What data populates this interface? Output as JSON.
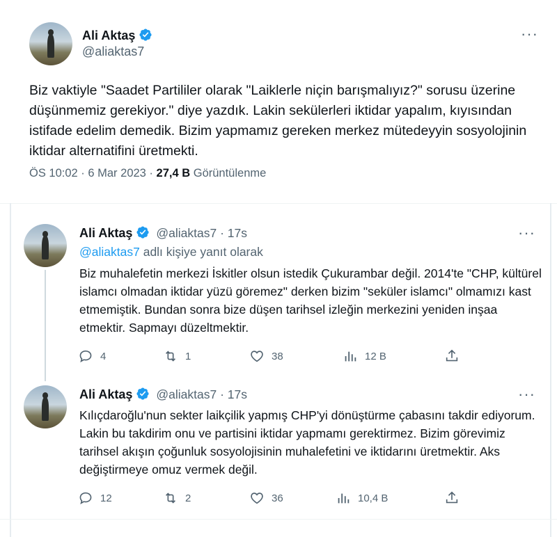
{
  "main_tweet": {
    "name": "Ali Aktaş",
    "handle": "@aliaktas7",
    "text": "Biz vaktiyle \"Saadet Partililer olarak \"Laiklerle niçin barışmalıyız?\" sorusu üzerine düşünmemiz gerekiyor.\" diye yazdık. Lakin sekülerleri iktidar yapalım, kıyısından istifade edelim demedik. Bizim yapmamız gereken merkez mütedeyyin sosyolojinin iktidar alternatifini üretmekti.",
    "time": "ÖS 10:02 · 6 Mar 2023 · ",
    "views_count": "27,4 B",
    "views_label": "Görüntülenme",
    "more_label": "···"
  },
  "replies": [
    {
      "name": "Ali Aktaş",
      "handle_time": "@aliaktas7 · 17s",
      "replying_handle": "@aliaktas7",
      "replying_suffix": " adlı kişiye yanıt olarak",
      "text": "Biz muhalefetin merkezi İskitler olsun istedik Çukurambar değil. 2014'te \"CHP, kültürel islamcı olmadan iktidar yüzü göremez\" derken bizim \"seküler islamcı\" olmamızı kast etmemiştik. Bundan sonra bize düşen tarihsel izleğin merkezini yeniden inşaa etmektir. Sapmayı düzeltmektir.",
      "replies_count": "4",
      "retweets_count": "1",
      "likes_count": "38",
      "views_count": "12 B",
      "more_label": "···"
    },
    {
      "name": "Ali Aktaş",
      "handle_time": "@aliaktas7 · 17s",
      "text": "Kılıçdaroğlu'nun sekter laikçilik yapmış CHP'yi dönüştürme çabasını takdir ediyorum. Lakin bu takdirim onu ve partisini iktidar yapmamı gerektirmez. Bizim görevimiz tarihsel akışın çoğunluk sosyolojisinin muhalefetini ve iktidarını üretmektir. Aks değiştirmeye omuz vermek değil.",
      "replies_count": "12",
      "retweets_count": "2",
      "likes_count": "36",
      "views_count": "10,4 B",
      "more_label": "···"
    }
  ],
  "colors": {
    "accent": "#1d9bf0",
    "secondary_text": "#536471",
    "primary_text": "#0f1419"
  }
}
